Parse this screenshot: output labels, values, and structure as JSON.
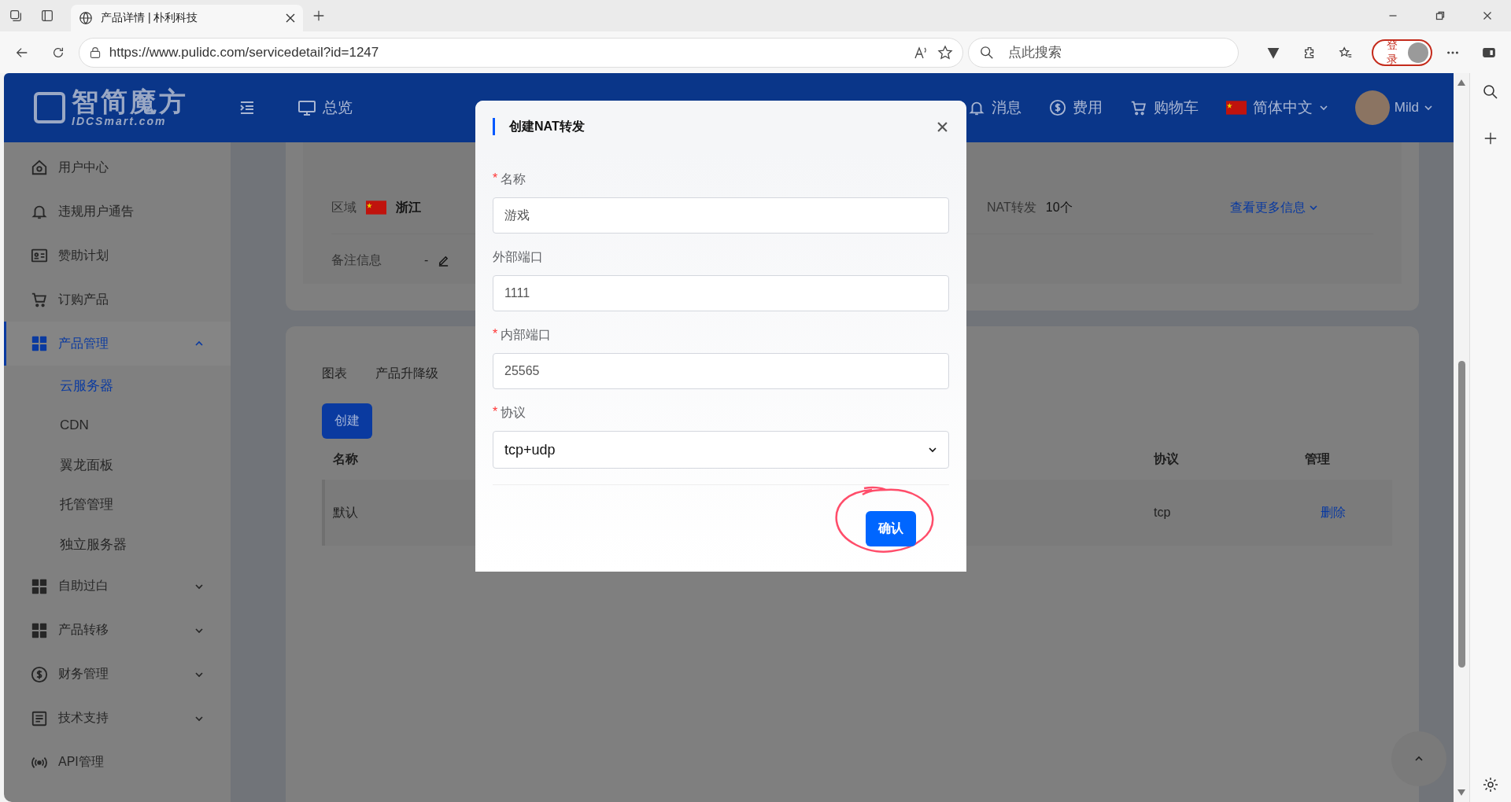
{
  "browser": {
    "tab_title": "产品详情 | 朴利科技",
    "url": "https://www.pulidc.com/servicedetail?id=1247",
    "search_placeholder": "点此搜索",
    "login": "登录"
  },
  "header": {
    "logo_title": "智简魔方",
    "logo_subtitle": "IDCSmart.com",
    "nav": [
      {
        "label": "总览"
      },
      {
        "label": "消息"
      },
      {
        "label": "费用"
      },
      {
        "label": "购物车"
      }
    ],
    "language": "简体中文",
    "user": "Mild"
  },
  "sidebar": {
    "items": [
      {
        "label": "用户中心",
        "selected": false
      },
      {
        "label": "违规用户通告",
        "selected": false
      },
      {
        "label": "赞助计划",
        "selected": false
      },
      {
        "label": "订购产品",
        "selected": false
      },
      {
        "label": "产品管理",
        "selected": true,
        "expanded": true,
        "children": [
          {
            "label": "云服务器",
            "selected": true
          },
          {
            "label": "CDN",
            "selected": false
          },
          {
            "label": "翼龙面板",
            "selected": false
          },
          {
            "label": "托管管理",
            "selected": false
          },
          {
            "label": "独立服务器",
            "selected": false
          }
        ]
      },
      {
        "label": "自助过白",
        "selected": false,
        "expanded": false
      },
      {
        "label": "产品转移",
        "selected": false,
        "expanded": false
      },
      {
        "label": "财务管理",
        "selected": false,
        "expanded": false
      },
      {
        "label": "技术支持",
        "selected": false,
        "expanded": false
      },
      {
        "label": "API管理",
        "selected": false
      }
    ]
  },
  "info": {
    "region_label": "区域",
    "region_value": "浙江",
    "nat_label": "NAT转发",
    "nat_value": "10个",
    "more_link": "查看更多信息",
    "remark_label": "备注信息",
    "remark_value": "-"
  },
  "tabs": [
    {
      "label": "图表"
    },
    {
      "label": "产品升降级"
    }
  ],
  "create_button": "创建",
  "table": {
    "columns": [
      "名称",
      "协议",
      "管理"
    ],
    "rows": [
      {
        "name": "默认",
        "protocol": "tcp",
        "action": "删除"
      }
    ]
  },
  "modal": {
    "title": "创建NAT转发",
    "required_mark": "*",
    "fields": [
      {
        "label": "名称",
        "required": true,
        "kind": "input",
        "value": "游戏"
      },
      {
        "label": "外部端口",
        "required": false,
        "kind": "input",
        "value": "1111"
      },
      {
        "label": "内部端口",
        "required": true,
        "kind": "input",
        "value": "25565"
      },
      {
        "label": "协议",
        "required": true,
        "kind": "select",
        "value": "tcp+udp"
      }
    ],
    "confirm": "确认"
  }
}
